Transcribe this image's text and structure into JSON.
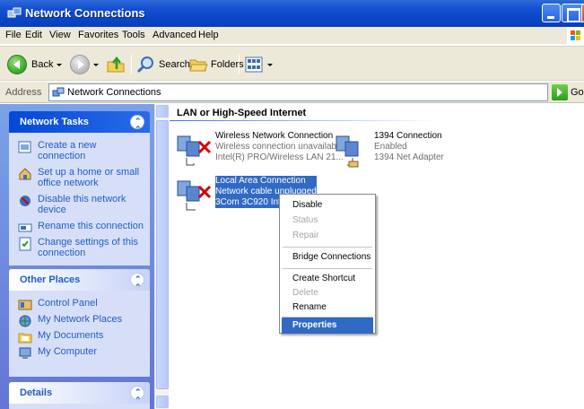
{
  "window": {
    "title": "Network Connections"
  },
  "menubar": [
    "File",
    "Edit",
    "View",
    "Favorites",
    "Tools",
    "Advanced",
    "Help"
  ],
  "toolbar": {
    "back": "Back",
    "search": "Search",
    "folders": "Folders"
  },
  "address": {
    "label": "Address",
    "value": "Network Connections",
    "go": "Go"
  },
  "taskpane": {
    "network_tasks": {
      "title": "Network Tasks",
      "items": [
        "Create a new connection",
        "Set up a home or small office network",
        "Disable this network device",
        "Rename this connection",
        "Change settings of this connection"
      ]
    },
    "other_places": {
      "title": "Other Places",
      "items": [
        "Control Panel",
        "My Network Places",
        "My Documents",
        "My Computer"
      ]
    },
    "details": {
      "title": "Details"
    }
  },
  "content": {
    "group_title": "LAN or High-Speed Internet",
    "connections": [
      {
        "name": "Wireless Network Connection",
        "status": "Wireless connection unavailable",
        "device": "Intel(R) PRO/Wireless LAN 21..."
      },
      {
        "name": "1394 Connection",
        "status": "Enabled",
        "device": "1394 Net Adapter"
      },
      {
        "name": "Local Area Connection",
        "status": "Network cable unplugged",
        "device": "3Com 3C920 Inte"
      }
    ]
  },
  "context_menu": {
    "items": [
      {
        "label": "Disable",
        "enabled": true
      },
      {
        "label": "Status",
        "enabled": false
      },
      {
        "label": "Repair",
        "enabled": false
      },
      {
        "label": "Bridge Connections",
        "enabled": true
      },
      {
        "label": "Create Shortcut",
        "enabled": true
      },
      {
        "label": "Delete",
        "enabled": false
      },
      {
        "label": "Rename",
        "enabled": true
      },
      {
        "label": "Properties",
        "enabled": true,
        "highlighted": true
      }
    ]
  },
  "colors": {
    "titlebar": "#0a45c8",
    "taskpane": "#6375d6",
    "selection": "#316ac5",
    "link": "#215dc6"
  }
}
